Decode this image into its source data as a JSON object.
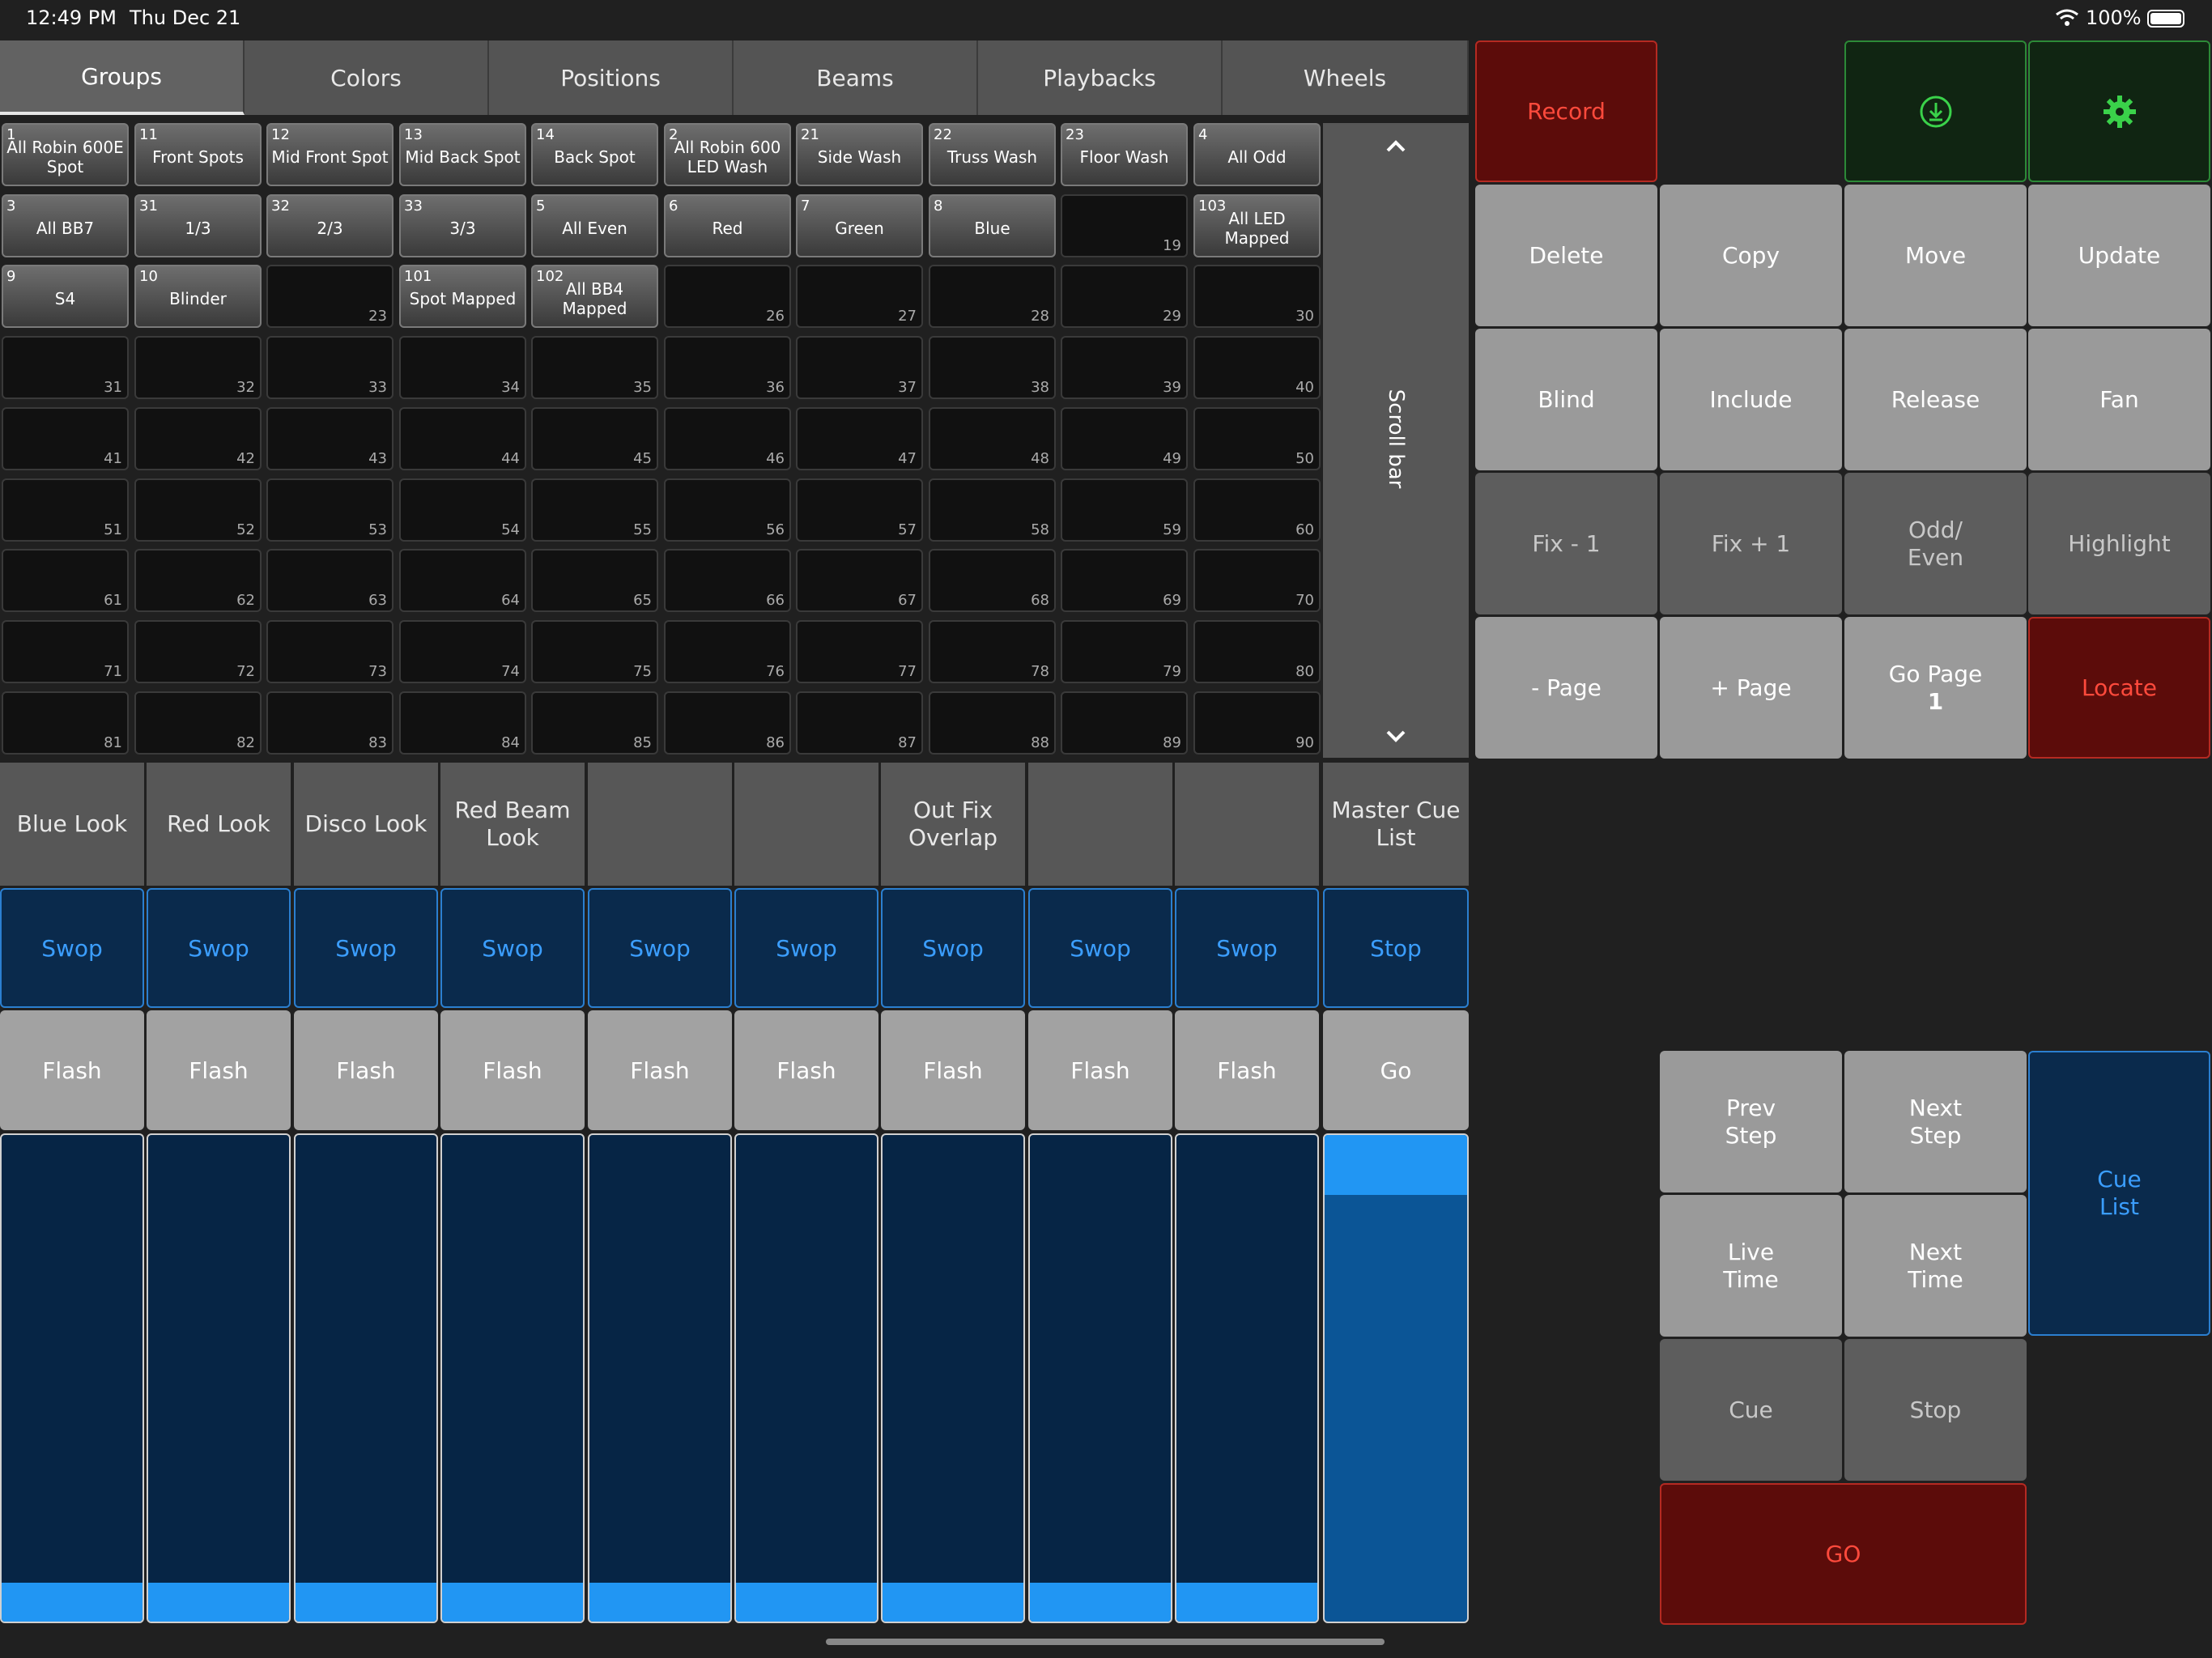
{
  "status": {
    "time": "12:49 PM",
    "date": "Thu Dec 21",
    "battery": "100%"
  },
  "tabs": [
    "Groups",
    "Colors",
    "Positions",
    "Beams",
    "Playbacks",
    "Wheels"
  ],
  "groups": [
    {
      "num": "1",
      "label": "All Robin 600E Spot"
    },
    {
      "num": "11",
      "label": "Front Spots"
    },
    {
      "num": "12",
      "label": "Mid Front Spot"
    },
    {
      "num": "13",
      "label": "Mid Back Spot"
    },
    {
      "num": "14",
      "label": "Back Spot"
    },
    {
      "num": "2",
      "label": "All Robin 600 LED Wash"
    },
    {
      "num": "21",
      "label": "Side Wash"
    },
    {
      "num": "22",
      "label": "Truss Wash"
    },
    {
      "num": "23",
      "label": "Floor Wash"
    },
    {
      "num": "4",
      "label": "All Odd"
    },
    {
      "num": "3",
      "label": "All BB7"
    },
    {
      "num": "31",
      "label": "1/3"
    },
    {
      "num": "32",
      "label": "2/3"
    },
    {
      "num": "33",
      "label": "3/3"
    },
    {
      "num": "5",
      "label": "All Even"
    },
    {
      "num": "6",
      "label": "Red"
    },
    {
      "num": "7",
      "label": "Green"
    },
    {
      "num": "8",
      "label": "Blue"
    },
    {
      "num": "19",
      "label": ""
    },
    {
      "num": "103",
      "label": "All LED Mapped"
    },
    {
      "num": "9",
      "label": "S4"
    },
    {
      "num": "10",
      "label": "Blinder"
    },
    {
      "num": "23",
      "label": ""
    },
    {
      "num": "101",
      "label": "Spot Mapped"
    },
    {
      "num": "102",
      "label": "All BB4 Mapped"
    },
    {
      "num": "26",
      "label": ""
    },
    {
      "num": "27",
      "label": ""
    },
    {
      "num": "28",
      "label": ""
    },
    {
      "num": "29",
      "label": ""
    },
    {
      "num": "30",
      "label": ""
    },
    {
      "num": "31",
      "label": ""
    },
    {
      "num": "32",
      "label": ""
    },
    {
      "num": "33",
      "label": ""
    },
    {
      "num": "34",
      "label": ""
    },
    {
      "num": "35",
      "label": ""
    },
    {
      "num": "36",
      "label": ""
    },
    {
      "num": "37",
      "label": ""
    },
    {
      "num": "38",
      "label": ""
    },
    {
      "num": "39",
      "label": ""
    },
    {
      "num": "40",
      "label": ""
    },
    {
      "num": "41",
      "label": ""
    },
    {
      "num": "42",
      "label": ""
    },
    {
      "num": "43",
      "label": ""
    },
    {
      "num": "44",
      "label": ""
    },
    {
      "num": "45",
      "label": ""
    },
    {
      "num": "46",
      "label": ""
    },
    {
      "num": "47",
      "label": ""
    },
    {
      "num": "48",
      "label": ""
    },
    {
      "num": "49",
      "label": ""
    },
    {
      "num": "50",
      "label": ""
    },
    {
      "num": "51",
      "label": ""
    },
    {
      "num": "52",
      "label": ""
    },
    {
      "num": "53",
      "label": ""
    },
    {
      "num": "54",
      "label": ""
    },
    {
      "num": "55",
      "label": ""
    },
    {
      "num": "56",
      "label": ""
    },
    {
      "num": "57",
      "label": ""
    },
    {
      "num": "58",
      "label": ""
    },
    {
      "num": "59",
      "label": ""
    },
    {
      "num": "60",
      "label": ""
    },
    {
      "num": "61",
      "label": ""
    },
    {
      "num": "62",
      "label": ""
    },
    {
      "num": "63",
      "label": ""
    },
    {
      "num": "64",
      "label": ""
    },
    {
      "num": "65",
      "label": ""
    },
    {
      "num": "66",
      "label": ""
    },
    {
      "num": "67",
      "label": ""
    },
    {
      "num": "68",
      "label": ""
    },
    {
      "num": "69",
      "label": ""
    },
    {
      "num": "70",
      "label": ""
    },
    {
      "num": "71",
      "label": ""
    },
    {
      "num": "72",
      "label": ""
    },
    {
      "num": "73",
      "label": ""
    },
    {
      "num": "74",
      "label": ""
    },
    {
      "num": "75",
      "label": ""
    },
    {
      "num": "76",
      "label": ""
    },
    {
      "num": "77",
      "label": ""
    },
    {
      "num": "78",
      "label": ""
    },
    {
      "num": "79",
      "label": ""
    },
    {
      "num": "80",
      "label": ""
    },
    {
      "num": "81",
      "label": ""
    },
    {
      "num": "82",
      "label": ""
    },
    {
      "num": "83",
      "label": ""
    },
    {
      "num": "84",
      "label": ""
    },
    {
      "num": "85",
      "label": ""
    },
    {
      "num": "86",
      "label": ""
    },
    {
      "num": "87",
      "label": ""
    },
    {
      "num": "88",
      "label": ""
    },
    {
      "num": "89",
      "label": ""
    },
    {
      "num": "90",
      "label": ""
    }
  ],
  "scrollbar": {
    "label": "Scroll bar",
    "up_icon": "chevron-up-icon",
    "down_icon": "chevron-down-icon"
  },
  "commands": {
    "record": "Record",
    "download_icon": "download-icon",
    "settings_icon": "gear-icon",
    "delete": "Delete",
    "copy": "Copy",
    "move": "Move",
    "update": "Update",
    "blind": "Blind",
    "include": "Include",
    "release": "Release",
    "fan": "Fan",
    "fix_minus": "Fix - 1",
    "fix_plus": "Fix + 1",
    "odd_even": "Odd/\nEven",
    "highlight": "Highlight",
    "page_minus": "- Page",
    "page_plus": "+ Page",
    "go_page": "Go Page",
    "go_page_num": "1",
    "locate": "Locate"
  },
  "playbacks": [
    {
      "name": "Blue Look",
      "swop": "Swop",
      "flash": "Flash",
      "level": 0.08
    },
    {
      "name": "Red Look",
      "swop": "Swop",
      "flash": "Flash",
      "level": 0.08
    },
    {
      "name": "Disco Look",
      "swop": "Swop",
      "flash": "Flash",
      "level": 0.08
    },
    {
      "name": "Red Beam Look",
      "swop": "Swop",
      "flash": "Flash",
      "level": 0.08
    },
    {
      "name": "",
      "swop": "Swop",
      "flash": "Flash",
      "level": 0.08
    },
    {
      "name": "",
      "swop": "Swop",
      "flash": "Flash",
      "level": 0.08
    },
    {
      "name": "Out Fix Overlap",
      "swop": "Swop",
      "flash": "Flash",
      "level": 0.08
    },
    {
      "name": "",
      "swop": "Swop",
      "flash": "Flash",
      "level": 0.08
    },
    {
      "name": "",
      "swop": "Swop",
      "flash": "Flash",
      "level": 0.08
    }
  ],
  "master": {
    "name": "Master Cue List",
    "stop": "Stop",
    "go": "Go",
    "level": 1.0
  },
  "cue_controls": {
    "prev_step": "Prev\nStep",
    "next_step": "Next\nStep",
    "cue_list": "Cue\nList",
    "live_time": "Live\nTime",
    "next_time": "Next\nTime",
    "cue": "Cue",
    "stop": "Stop",
    "go": "GO"
  },
  "colors": {
    "accent_blue": "#2196f3",
    "record_red": "#ff4a3c",
    "green": "#3ad24a"
  }
}
